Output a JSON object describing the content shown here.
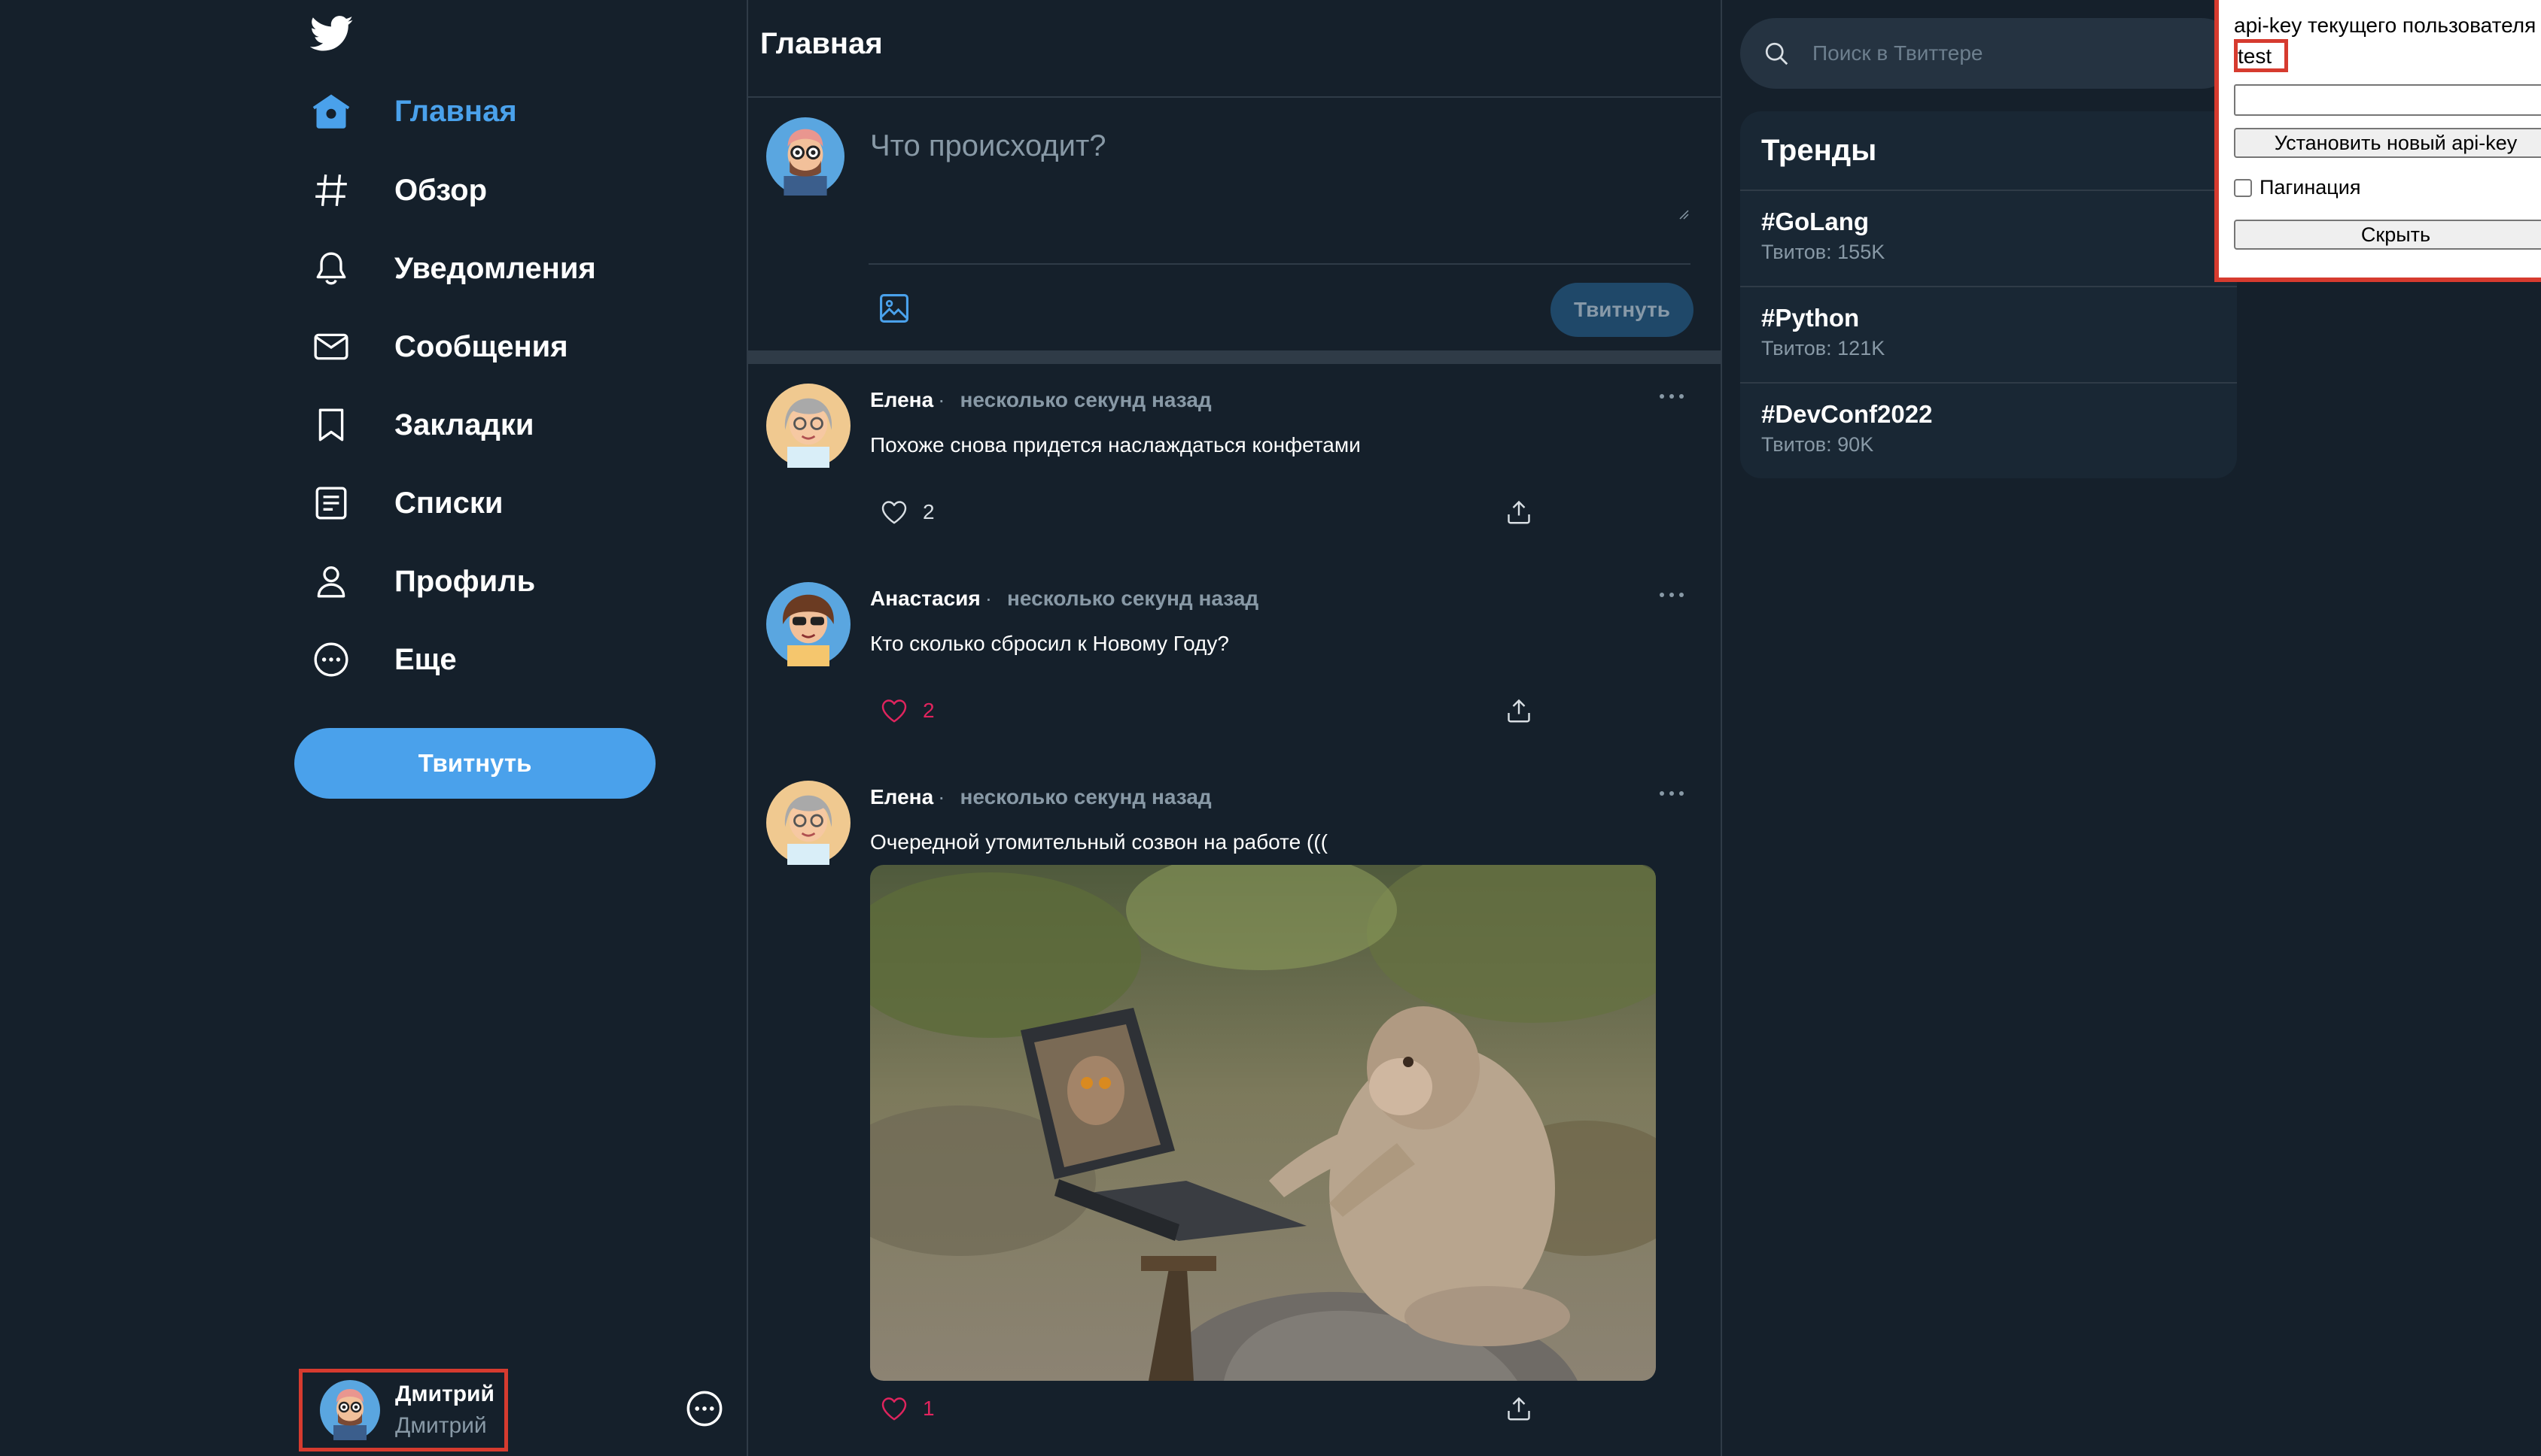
{
  "nav": {
    "items": [
      {
        "label": "Главная",
        "icon": "home-icon",
        "active": true
      },
      {
        "label": "Обзор",
        "icon": "hashtag-icon"
      },
      {
        "label": "Уведомления",
        "icon": "bell-icon"
      },
      {
        "label": "Сообщения",
        "icon": "envelope-icon"
      },
      {
        "label": "Закладки",
        "icon": "bookmark-icon"
      },
      {
        "label": "Списки",
        "icon": "list-icon"
      },
      {
        "label": "Профиль",
        "icon": "person-icon"
      },
      {
        "label": "Еще",
        "icon": "more-circle-icon"
      }
    ],
    "tweet_button": "Твитнуть"
  },
  "current_user": {
    "name": "Дмитрий",
    "handle": "Дмитрий"
  },
  "main": {
    "title": "Главная",
    "composer": {
      "placeholder": "Что происходит?",
      "button": "Твитнуть"
    }
  },
  "tweets": [
    {
      "author": "Елена",
      "separator": "·",
      "time": "несколько секунд назад",
      "text": "Похоже снова придется наслаждаться конфетами",
      "likes": "2",
      "liked": false
    },
    {
      "author": "Анастасия",
      "separator": "·",
      "time": "несколько секунд назад",
      "text": "Кто сколько сбросил к Новому Году?",
      "likes": "2",
      "liked": true
    },
    {
      "author": "Елена",
      "separator": "·",
      "time": "несколько секунд назад",
      "text": "Очередной утомительный созвон на работе (((",
      "likes": "1",
      "liked": true,
      "image": "monkey-with-laptop-photo"
    }
  ],
  "search": {
    "placeholder": "Поиск в Твиттере"
  },
  "trends": {
    "title": "Тренды",
    "items": [
      {
        "name": "#GoLang",
        "count": "Твитов: 155K"
      },
      {
        "name": "#Python",
        "count": "Твитов: 121K"
      },
      {
        "name": "#DevConf2022",
        "count": "Твитов: 90K"
      }
    ]
  },
  "api_panel": {
    "label": "api-key текущего пользователя",
    "current_key": "test",
    "input_value": "",
    "set_button": "Установить новый api-key",
    "pagination_label": "Пагинация",
    "pagination_checked": false,
    "hide_button": "Скрыть"
  },
  "colors": {
    "background": "#15202b",
    "accent": "#4aa1eb",
    "like": "#e0245e",
    "muted": "#8899a6",
    "highlight": "#d63b2f"
  }
}
